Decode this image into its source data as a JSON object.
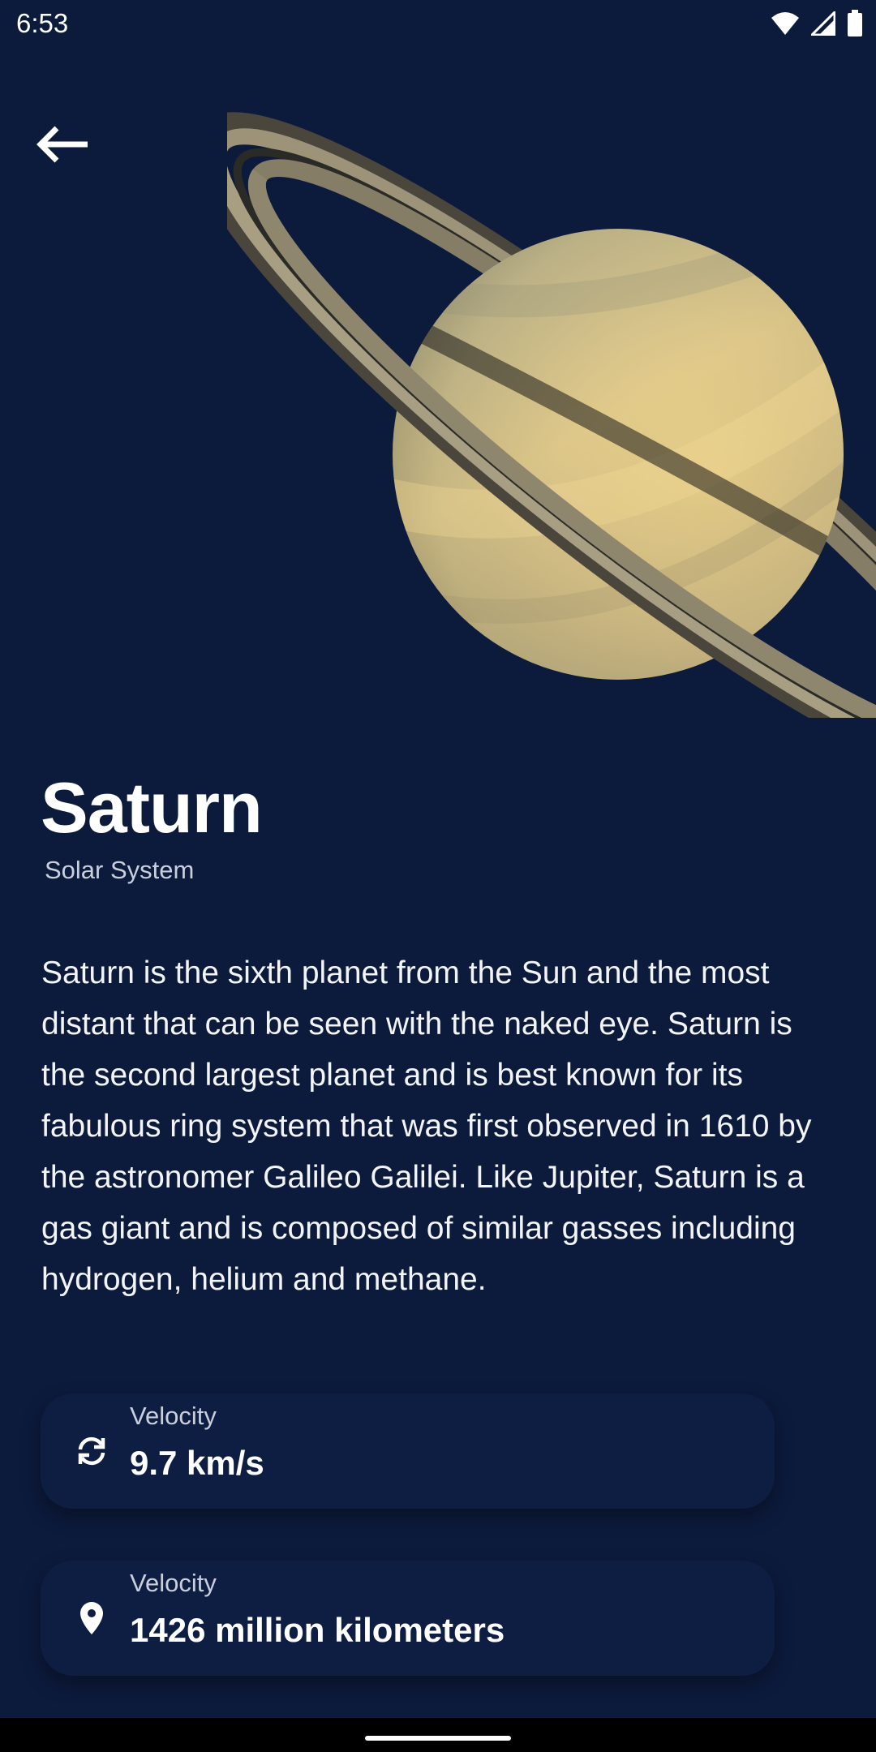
{
  "status_bar": {
    "time": "6:53",
    "icons": [
      "wifi-icon",
      "signal-icon",
      "battery-icon"
    ]
  },
  "header": {
    "back_icon": "arrow-back-icon"
  },
  "planet": {
    "name": "Saturn",
    "category": "Solar System",
    "description": "Saturn is the sixth planet from the Sun and the most distant that can be seen with the naked eye. Saturn is the second largest planet and is best known for its fabulous ring system that was first observed in 1610 by the astronomer Galileo Galilei. Like Jupiter, Saturn is a gas giant and is composed of similar gasses including hydrogen, helium and methane."
  },
  "stats": [
    {
      "icon": "rotate-icon",
      "label": "Velocity",
      "value": "9.7 km/s"
    },
    {
      "icon": "location-pin-icon",
      "label": "Velocity",
      "value": "1426 million kilometers"
    }
  ],
  "colors": {
    "background": "#0c1a3c",
    "card": "#0e1d42",
    "text_primary": "#ffffff",
    "text_secondary": "#c9cfdc"
  }
}
